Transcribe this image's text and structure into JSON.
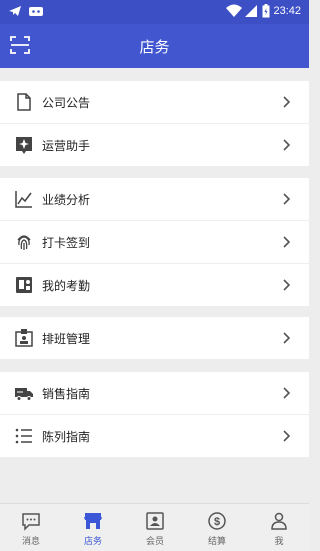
{
  "status": {
    "time": "23:42"
  },
  "header": {
    "title": "店务",
    "scan_icon": "scan-icon"
  },
  "groups": [
    {
      "items": [
        {
          "label": "公司公告",
          "icon": "document-icon"
        },
        {
          "label": "运营助手",
          "icon": "assistant-icon"
        }
      ]
    },
    {
      "items": [
        {
          "label": "业绩分析",
          "icon": "line-chart-icon"
        },
        {
          "label": "打卡签到",
          "icon": "fingerprint-icon"
        },
        {
          "label": "我的考勤",
          "icon": "attendance-icon"
        }
      ]
    },
    {
      "items": [
        {
          "label": "排班管理",
          "icon": "schedule-icon"
        }
      ]
    },
    {
      "items": [
        {
          "label": "销售指南",
          "icon": "truck-icon"
        },
        {
          "label": "陈列指南",
          "icon": "list-icon"
        }
      ]
    }
  ],
  "tabs": [
    {
      "label": "消息",
      "icon": "message-icon"
    },
    {
      "label": "店务",
      "icon": "store-icon",
      "active": true
    },
    {
      "label": "会员",
      "icon": "member-icon"
    },
    {
      "label": "结算",
      "icon": "dollar-icon"
    },
    {
      "label": "我",
      "icon": "profile-icon"
    }
  ],
  "colors": {
    "primary": "#4257cf",
    "statusbar": "#3c4fc4",
    "active_tab": "#3b56d6"
  }
}
